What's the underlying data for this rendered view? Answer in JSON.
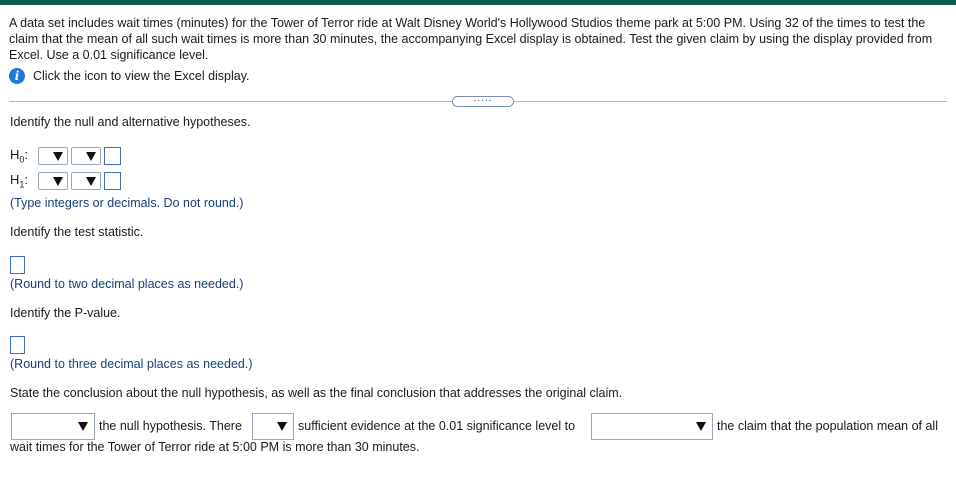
{
  "problem": {
    "intro": "A data set includes wait times (minutes) for the Tower of Terror ride at Walt Disney World's Hollywood Studios theme park at 5:00 PM. Using 32 of the times to test the claim that the mean of all such wait times is more than 30 minutes, the accompanying Excel display is obtained. Test the given claim by using the display provided from Excel. Use a 0.01 significance level.",
    "info_link": "Click the icon to view the Excel display.",
    "expander": "....."
  },
  "hypotheses": {
    "prompt": "Identify the null and alternative hypotheses.",
    "h0_main": "H",
    "h0_sub": "0",
    "h1_main": "H",
    "h1_sub": "1",
    "colon": ":",
    "hint": "(Type integers or decimals. Do not round.)"
  },
  "test_statistic": {
    "prompt": "Identify the test statistic.",
    "hint": "(Round to two decimal places as needed.)"
  },
  "p_value": {
    "prompt": "Identify the P-value.",
    "hint": "(Round to three decimal places as needed.)"
  },
  "conclusion": {
    "prompt": "State the conclusion about the null hypothesis, as well as the final conclusion that addresses the original claim.",
    "text1": "the null hypothesis. There",
    "text2": "sufficient evidence at the 0.01 significance level to",
    "text3": "the claim that the population mean of all",
    "text4": "wait times for the Tower of Terror ride at 5:00 PM is more than 30 minutes."
  },
  "colors": {
    "top_bar": "#0f5e4d",
    "info_icon": "#1f7ad9",
    "input_border": "#3b6cc2",
    "hint_text": "#1a3f7a"
  }
}
